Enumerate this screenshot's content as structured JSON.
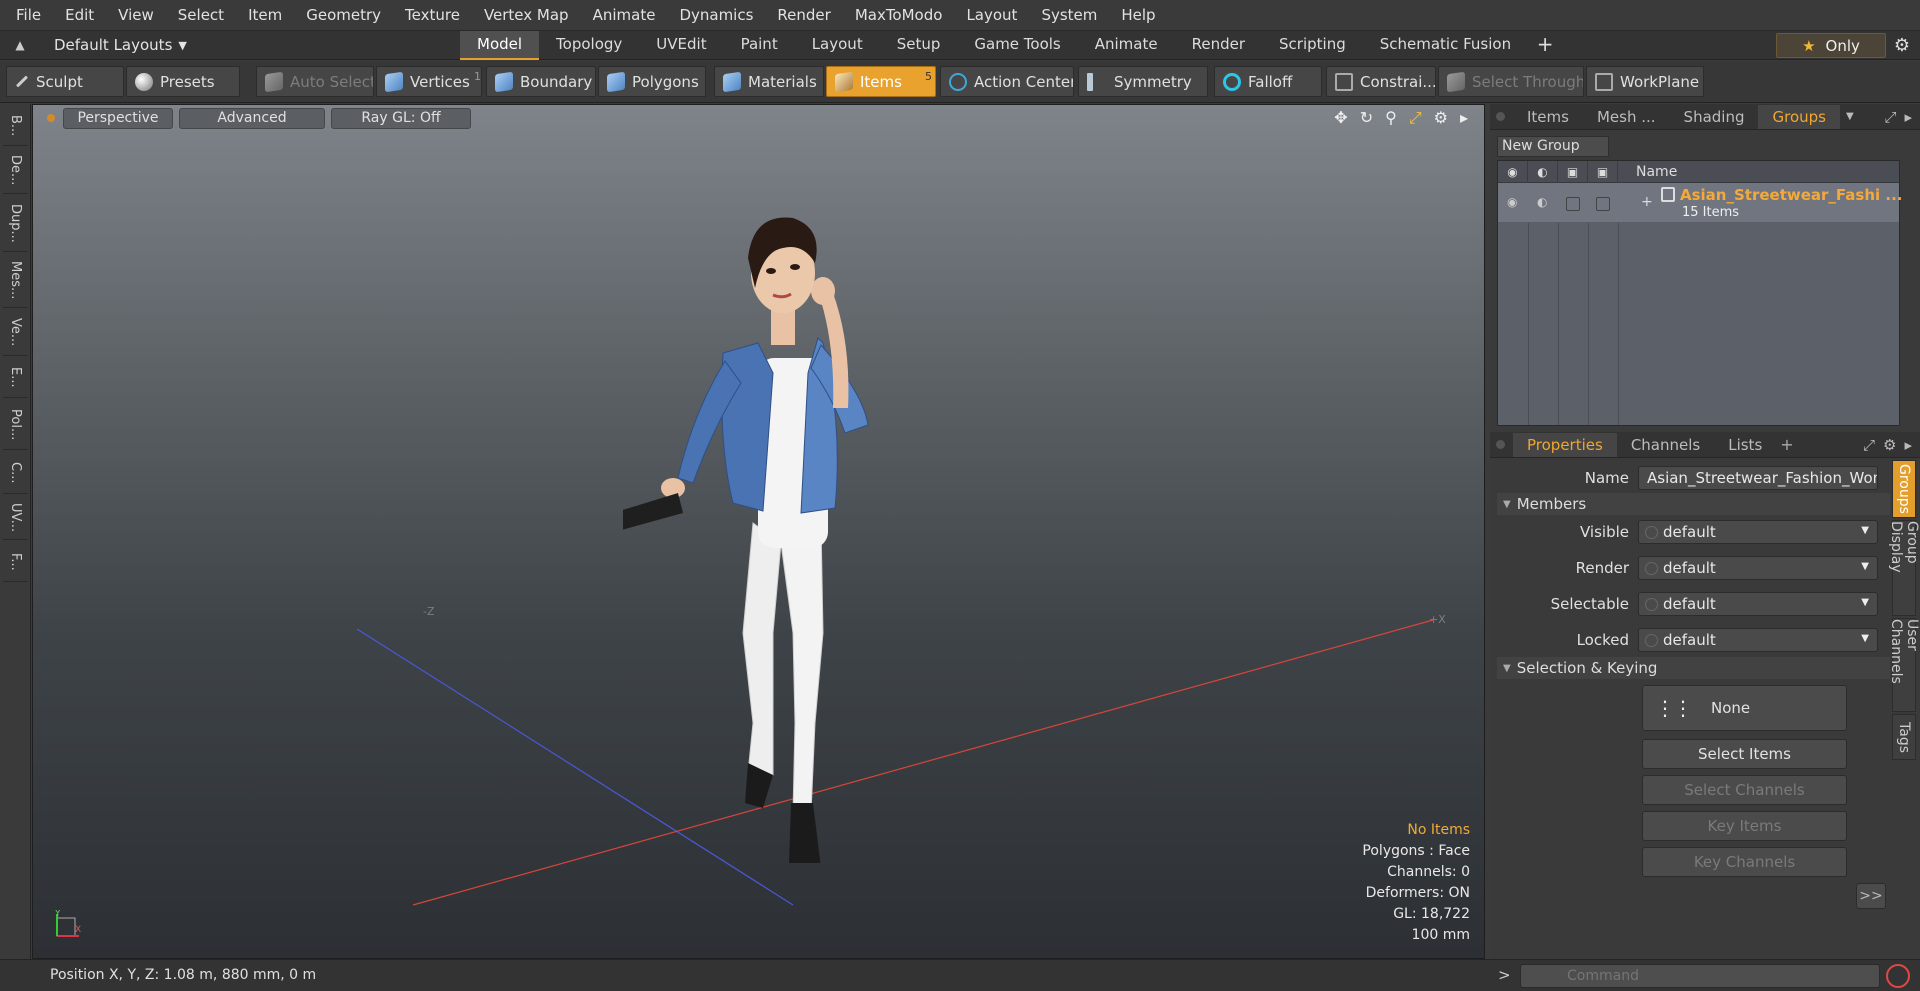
{
  "menu": [
    "File",
    "Edit",
    "View",
    "Select",
    "Item",
    "Geometry",
    "Texture",
    "Vertex Map",
    "Animate",
    "Dynamics",
    "Render",
    "MaxToModo",
    "Layout",
    "System",
    "Help"
  ],
  "layout_bar": {
    "layout_name": "Default Layouts",
    "tabs": [
      "Model",
      "Topology",
      "UVEdit",
      "Paint",
      "Layout",
      "Setup",
      "Game Tools",
      "Animate",
      "Render",
      "Scripting",
      "Schematic Fusion"
    ],
    "active_tab": "Model",
    "add": "+",
    "only_label": "Only"
  },
  "toolbar": {
    "sculpt": "Sculpt",
    "presets": "Presets",
    "auto_select": "Auto Select",
    "vertices": "Vertices",
    "vertices_count": "1",
    "boundary": "Boundary",
    "polygons": "Polygons",
    "materials": "Materials",
    "items": "Items",
    "items_count": "5",
    "action_center": "Action Center",
    "symmetry": "Symmetry",
    "falloff": "Falloff",
    "constraints": "Constrai...",
    "select_through": "Select Through",
    "workplane": "WorkPlane"
  },
  "left_tabs": [
    "B...",
    "De...",
    "Dup...",
    "Mes...",
    "Ve...",
    "E...",
    "Pol...",
    "C...",
    "UV...",
    "F..."
  ],
  "viewport": {
    "view_mode": "Perspective",
    "shading": "Advanced",
    "raygl": "Ray GL: Off",
    "info": {
      "items": "No Items",
      "polygons": "Polygons : Face",
      "channels": "Channels: 0",
      "deformers": "Deformers: ON",
      "gl": "GL: 18,722",
      "scale": "100 mm"
    },
    "axis_x": "X",
    "axis_y": "Y",
    "grid_label_neg_z": "-Z",
    "grid_label_pos_x": "+X"
  },
  "groups_panel": {
    "tabs": [
      "Items",
      "Mesh ...",
      "Shading",
      "Groups"
    ],
    "active_tab": "Groups",
    "new_group": "New Group",
    "name_header": "Name",
    "group_name": "Asian_Streetwear_Fashi ...",
    "group_count": "15 Items"
  },
  "properties_panel": {
    "tabs": [
      "Properties",
      "Channels",
      "Lists"
    ],
    "active_tab": "Properties",
    "name_label": "Name",
    "name_value": "Asian_Streetwear_Fashion_Wom",
    "members_section": "Members",
    "visible_label": "Visible",
    "visible_value": "default",
    "render_label": "Render",
    "render_value": "default",
    "selectable_label": "Selectable",
    "selectable_value": "default",
    "locked_label": "Locked",
    "locked_value": "default",
    "selection_section": "Selection & Keying",
    "none_label": "None",
    "select_items": "Select Items",
    "select_channels": "Select Channels",
    "key_items": "Key Items",
    "key_channels": "Key Channels",
    "more": ">>",
    "side_tabs": [
      "Groups",
      "Group Display",
      "User Channels",
      "Tags"
    ]
  },
  "statusbar": {
    "position": "Position X, Y, Z:   1.08 m, 880 mm, 0 m",
    "command_placeholder": "Command"
  }
}
